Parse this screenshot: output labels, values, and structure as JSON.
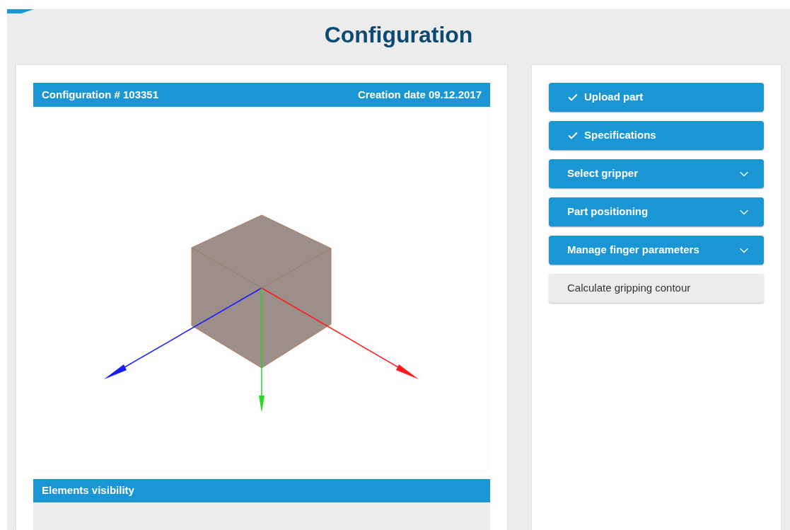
{
  "page_title": "Configuration",
  "viewer": {
    "title": "Configuration # 103351",
    "date": "Creation date 09.12.2017"
  },
  "visibility": {
    "title": "Elements visibility"
  },
  "steps": [
    {
      "label": "Upload part",
      "kind": "done"
    },
    {
      "label": "Specifications",
      "kind": "done"
    },
    {
      "label": "Select gripper",
      "kind": "expandable"
    },
    {
      "label": "Part positioning",
      "kind": "expandable"
    },
    {
      "label": "Manage finger parameters",
      "kind": "expandable"
    },
    {
      "label": "Calculate gripping contour",
      "kind": "action"
    }
  ]
}
